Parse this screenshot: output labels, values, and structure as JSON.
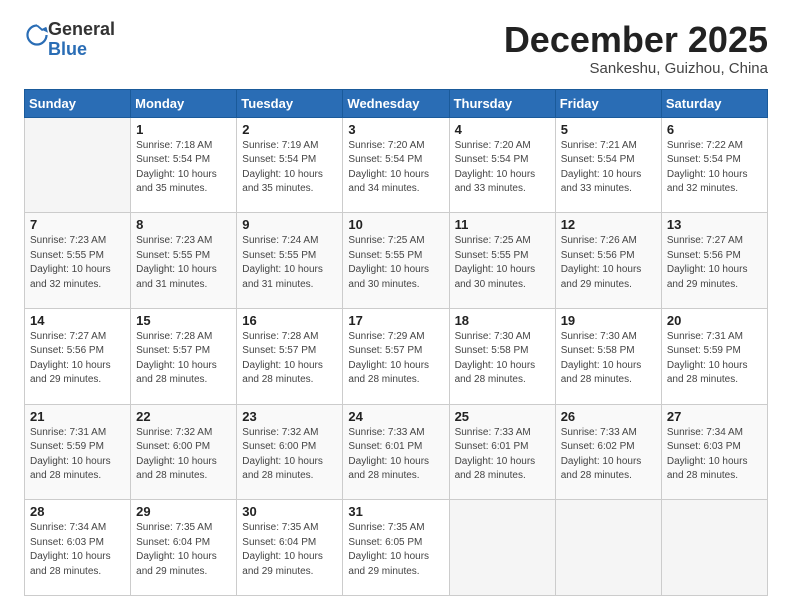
{
  "logo": {
    "general": "General",
    "blue": "Blue"
  },
  "header": {
    "month": "December 2025",
    "location": "Sankeshu, Guizhou, China"
  },
  "weekdays": [
    "Sunday",
    "Monday",
    "Tuesday",
    "Wednesday",
    "Thursday",
    "Friday",
    "Saturday"
  ],
  "weeks": [
    [
      {
        "day": "",
        "info": ""
      },
      {
        "day": "1",
        "info": "Sunrise: 7:18 AM\nSunset: 5:54 PM\nDaylight: 10 hours\nand 35 minutes."
      },
      {
        "day": "2",
        "info": "Sunrise: 7:19 AM\nSunset: 5:54 PM\nDaylight: 10 hours\nand 35 minutes."
      },
      {
        "day": "3",
        "info": "Sunrise: 7:20 AM\nSunset: 5:54 PM\nDaylight: 10 hours\nand 34 minutes."
      },
      {
        "day": "4",
        "info": "Sunrise: 7:20 AM\nSunset: 5:54 PM\nDaylight: 10 hours\nand 33 minutes."
      },
      {
        "day": "5",
        "info": "Sunrise: 7:21 AM\nSunset: 5:54 PM\nDaylight: 10 hours\nand 33 minutes."
      },
      {
        "day": "6",
        "info": "Sunrise: 7:22 AM\nSunset: 5:54 PM\nDaylight: 10 hours\nand 32 minutes."
      }
    ],
    [
      {
        "day": "7",
        "info": "Sunrise: 7:23 AM\nSunset: 5:55 PM\nDaylight: 10 hours\nand 32 minutes."
      },
      {
        "day": "8",
        "info": "Sunrise: 7:23 AM\nSunset: 5:55 PM\nDaylight: 10 hours\nand 31 minutes."
      },
      {
        "day": "9",
        "info": "Sunrise: 7:24 AM\nSunset: 5:55 PM\nDaylight: 10 hours\nand 31 minutes."
      },
      {
        "day": "10",
        "info": "Sunrise: 7:25 AM\nSunset: 5:55 PM\nDaylight: 10 hours\nand 30 minutes."
      },
      {
        "day": "11",
        "info": "Sunrise: 7:25 AM\nSunset: 5:55 PM\nDaylight: 10 hours\nand 30 minutes."
      },
      {
        "day": "12",
        "info": "Sunrise: 7:26 AM\nSunset: 5:56 PM\nDaylight: 10 hours\nand 29 minutes."
      },
      {
        "day": "13",
        "info": "Sunrise: 7:27 AM\nSunset: 5:56 PM\nDaylight: 10 hours\nand 29 minutes."
      }
    ],
    [
      {
        "day": "14",
        "info": "Sunrise: 7:27 AM\nSunset: 5:56 PM\nDaylight: 10 hours\nand 29 minutes."
      },
      {
        "day": "15",
        "info": "Sunrise: 7:28 AM\nSunset: 5:57 PM\nDaylight: 10 hours\nand 28 minutes."
      },
      {
        "day": "16",
        "info": "Sunrise: 7:28 AM\nSunset: 5:57 PM\nDaylight: 10 hours\nand 28 minutes."
      },
      {
        "day": "17",
        "info": "Sunrise: 7:29 AM\nSunset: 5:57 PM\nDaylight: 10 hours\nand 28 minutes."
      },
      {
        "day": "18",
        "info": "Sunrise: 7:30 AM\nSunset: 5:58 PM\nDaylight: 10 hours\nand 28 minutes."
      },
      {
        "day": "19",
        "info": "Sunrise: 7:30 AM\nSunset: 5:58 PM\nDaylight: 10 hours\nand 28 minutes."
      },
      {
        "day": "20",
        "info": "Sunrise: 7:31 AM\nSunset: 5:59 PM\nDaylight: 10 hours\nand 28 minutes."
      }
    ],
    [
      {
        "day": "21",
        "info": "Sunrise: 7:31 AM\nSunset: 5:59 PM\nDaylight: 10 hours\nand 28 minutes."
      },
      {
        "day": "22",
        "info": "Sunrise: 7:32 AM\nSunset: 6:00 PM\nDaylight: 10 hours\nand 28 minutes."
      },
      {
        "day": "23",
        "info": "Sunrise: 7:32 AM\nSunset: 6:00 PM\nDaylight: 10 hours\nand 28 minutes."
      },
      {
        "day": "24",
        "info": "Sunrise: 7:33 AM\nSunset: 6:01 PM\nDaylight: 10 hours\nand 28 minutes."
      },
      {
        "day": "25",
        "info": "Sunrise: 7:33 AM\nSunset: 6:01 PM\nDaylight: 10 hours\nand 28 minutes."
      },
      {
        "day": "26",
        "info": "Sunrise: 7:33 AM\nSunset: 6:02 PM\nDaylight: 10 hours\nand 28 minutes."
      },
      {
        "day": "27",
        "info": "Sunrise: 7:34 AM\nSunset: 6:03 PM\nDaylight: 10 hours\nand 28 minutes."
      }
    ],
    [
      {
        "day": "28",
        "info": "Sunrise: 7:34 AM\nSunset: 6:03 PM\nDaylight: 10 hours\nand 28 minutes."
      },
      {
        "day": "29",
        "info": "Sunrise: 7:35 AM\nSunset: 6:04 PM\nDaylight: 10 hours\nand 29 minutes."
      },
      {
        "day": "30",
        "info": "Sunrise: 7:35 AM\nSunset: 6:04 PM\nDaylight: 10 hours\nand 29 minutes."
      },
      {
        "day": "31",
        "info": "Sunrise: 7:35 AM\nSunset: 6:05 PM\nDaylight: 10 hours\nand 29 minutes."
      },
      {
        "day": "",
        "info": ""
      },
      {
        "day": "",
        "info": ""
      },
      {
        "day": "",
        "info": ""
      }
    ]
  ]
}
